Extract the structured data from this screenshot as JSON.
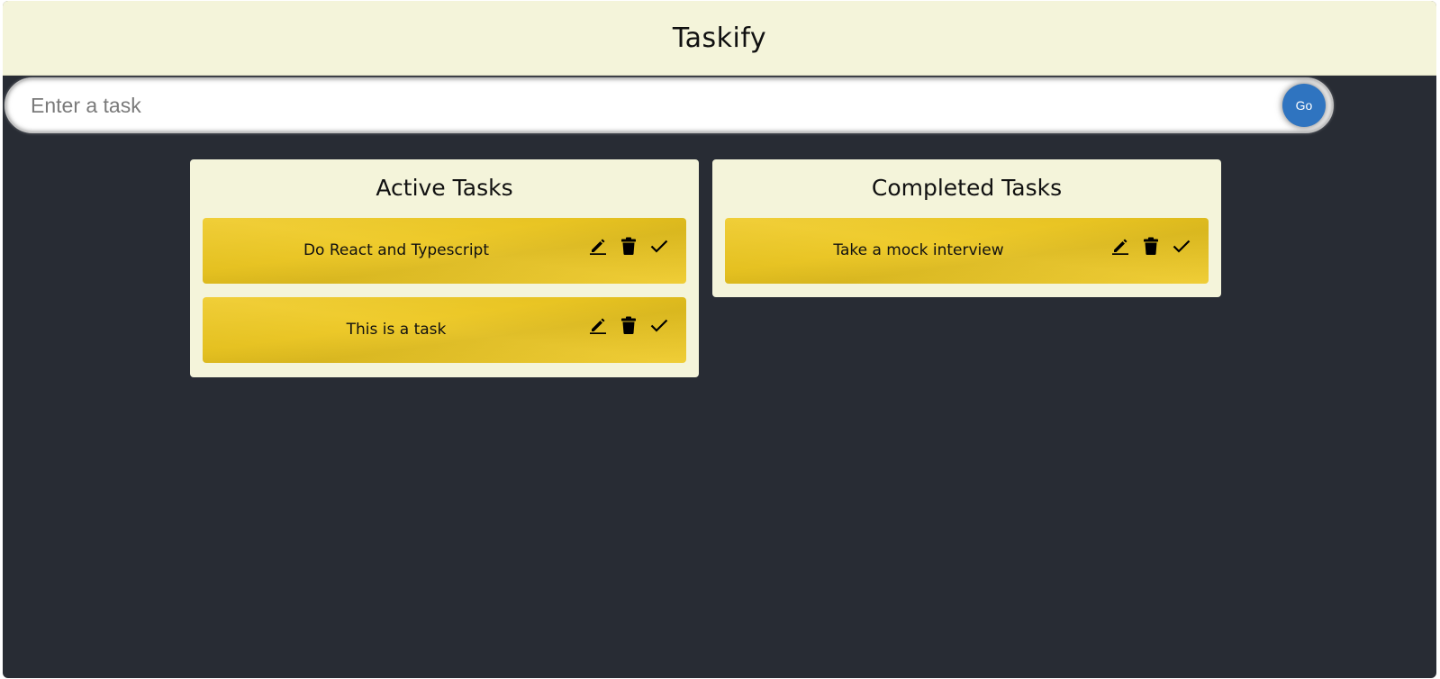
{
  "header": {
    "title": "Taskify"
  },
  "input": {
    "placeholder": "Enter a task",
    "value": "",
    "submit_label": "Go"
  },
  "columns": {
    "active": {
      "title": "Active Tasks",
      "tasks": [
        {
          "text": "Do React and Typescript"
        },
        {
          "text": "This is a task"
        }
      ]
    },
    "completed": {
      "title": "Completed Tasks",
      "tasks": [
        {
          "text": "Take a mock interview"
        }
      ]
    }
  },
  "task_actions": [
    "edit-icon",
    "delete-icon",
    "check-icon"
  ],
  "colors": {
    "background": "#282c34",
    "header": "#f4f4da",
    "column": "#f4f4da",
    "card": "#eec81f",
    "go_button": "#2f74c0"
  }
}
